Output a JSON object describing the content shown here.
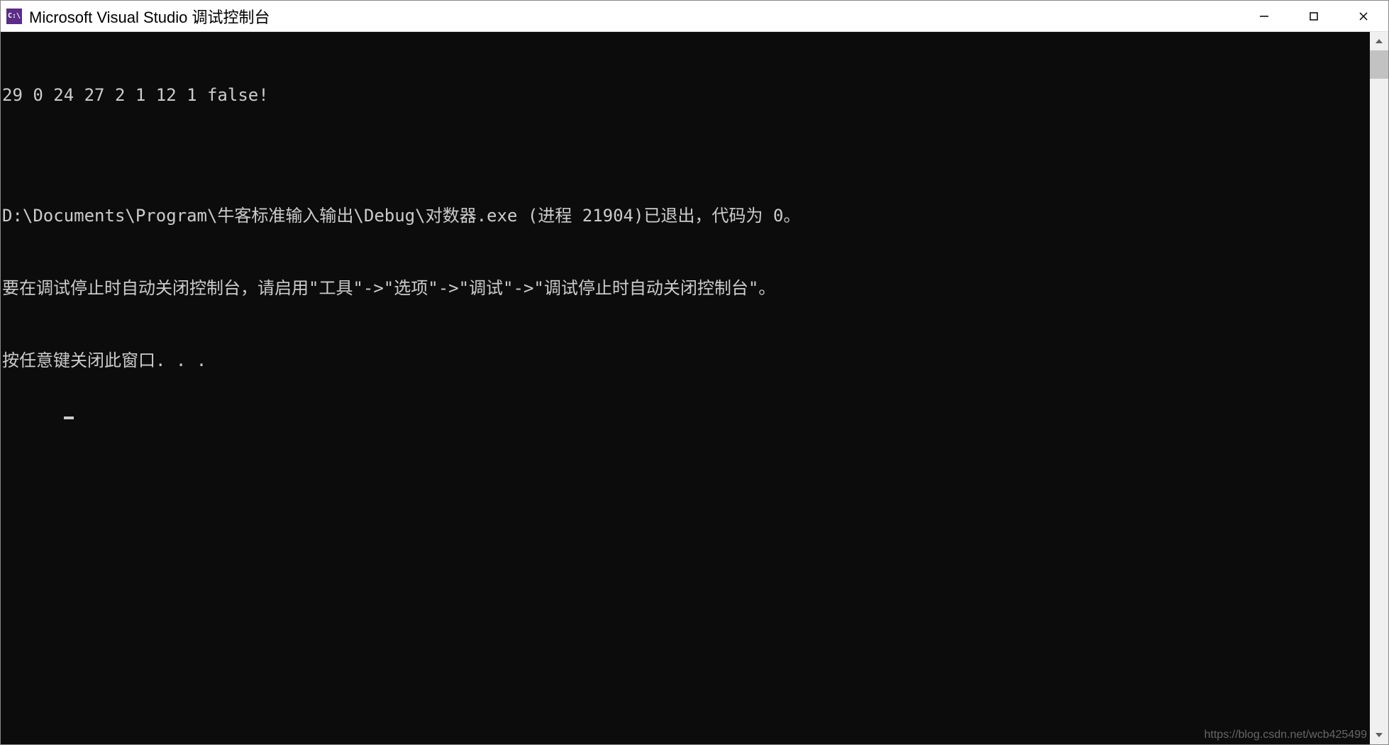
{
  "window": {
    "title": "Microsoft Visual Studio 调试控制台",
    "icon_label": "C:\\"
  },
  "console": {
    "lines": [
      "29 0 24 27 2 1 12 1 false!",
      "",
      "D:\\Documents\\Program\\牛客标准输入输出\\Debug\\对数器.exe (进程 21904)已退出，代码为 0。",
      "要在调试停止时自动关闭控制台，请启用\"工具\"->\"选项\"->\"调试\"->\"调试停止时自动关闭控制台\"。",
      "按任意键关闭此窗口. . ."
    ]
  },
  "watermark": "https://blog.csdn.net/wcb425499"
}
